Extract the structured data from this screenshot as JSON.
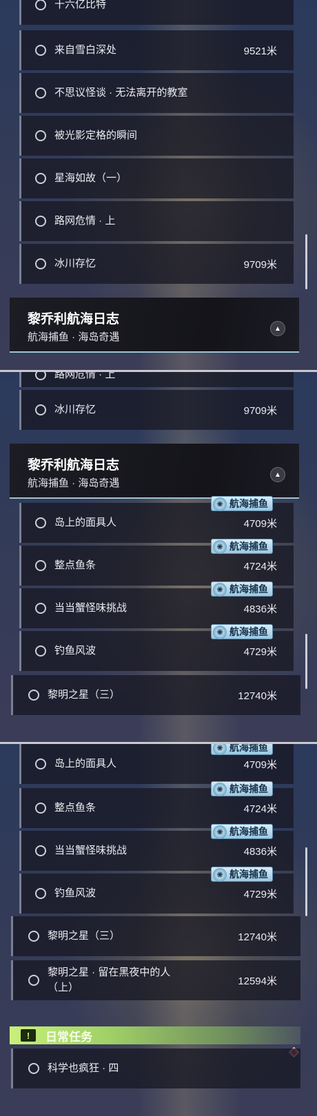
{
  "panel1": {
    "partial_top": "十六亿比特",
    "rows": [
      {
        "label": "来自雪白深处",
        "dist": "9521米"
      },
      {
        "label": "不思议怪谈 · 无法离开的教室",
        "dist": ""
      },
      {
        "label": "被光影定格的瞬间",
        "dist": ""
      },
      {
        "label": "星海如故（一）",
        "dist": ""
      },
      {
        "label": "路网危情 · 上",
        "dist": ""
      },
      {
        "label": "冰川存忆",
        "dist": "9709米"
      }
    ],
    "section": {
      "title": "黎乔利航海日志",
      "subtitle": "航海捕鱼 · 海岛奇遇"
    }
  },
  "panel2": {
    "partial_top": "路网危情 · 上",
    "rows_top": [
      {
        "label": "冰川存忆",
        "dist": "9709米"
      }
    ],
    "section": {
      "title": "黎乔利航海日志",
      "subtitle": "航海捕鱼 · 海岛奇遇"
    },
    "tagged_rows": [
      {
        "label": "岛上的面具人",
        "dist": "4709米",
        "tag": "航海捕鱼"
      },
      {
        "label": "整点鱼条",
        "dist": "4724米",
        "tag": "航海捕鱼"
      },
      {
        "label": "当当蟹怪味挑战",
        "dist": "4836米",
        "tag": "航海捕鱼"
      },
      {
        "label": "钓鱼风波",
        "dist": "4729米",
        "tag": "航海捕鱼"
      }
    ],
    "wide_rows": [
      {
        "label": "黎明之星（三）",
        "dist": "12740米"
      }
    ]
  },
  "panel3": {
    "tagged_rows": [
      {
        "label": "岛上的面具人",
        "dist": "4709米",
        "tag": "航海捕鱼"
      },
      {
        "label": "整点鱼条",
        "dist": "4724米",
        "tag": "航海捕鱼"
      },
      {
        "label": "当当蟹怪味挑战",
        "dist": "4836米",
        "tag": "航海捕鱼"
      },
      {
        "label": "钓鱼风波",
        "dist": "4729米",
        "tag": "航海捕鱼"
      }
    ],
    "wide_rows": [
      {
        "label": "黎明之星（三）",
        "dist": "12740米"
      },
      {
        "label": "黎明之星 · 留在黑夜中的人（上）",
        "dist": "12594米"
      }
    ],
    "daily": {
      "alert": "!",
      "title": "日常任务"
    },
    "daily_rows": [
      {
        "label": "科学也疯狂 · 四",
        "dist": ""
      }
    ]
  },
  "colors": {
    "accent_green": "#c8f07a",
    "tag_blue": "#9cc7df",
    "marker_red": "#e0435a"
  },
  "icons": {
    "tag_icon": "fish-compass-icon",
    "collapse": "chevron-up-icon",
    "alert": "exclamation-icon",
    "marker": "red-diamond-icon"
  }
}
